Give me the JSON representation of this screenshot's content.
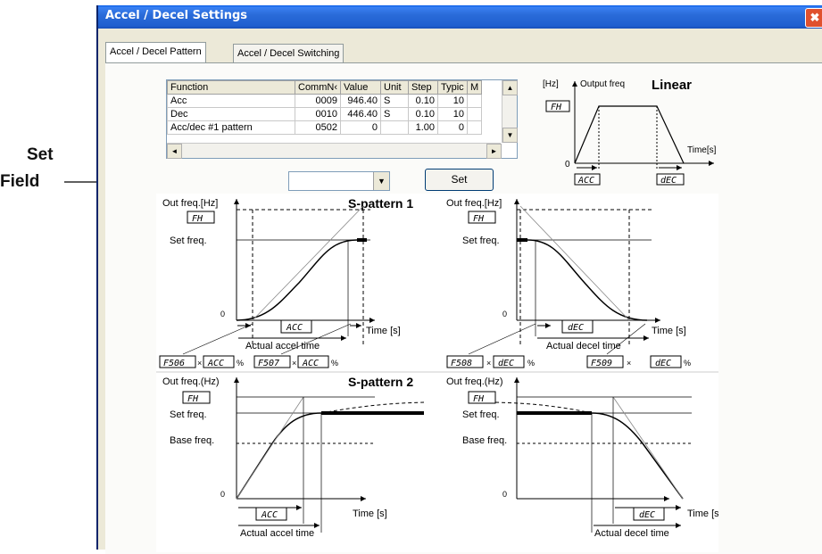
{
  "callout": {
    "line1": "Set",
    "line2": "Field"
  },
  "window": {
    "title": "Accel / Decel Settings",
    "close_glyph": "✖"
  },
  "tabs": [
    {
      "label": "Accel / Decel Pattern",
      "active": true
    },
    {
      "label": "Accel / Decel Switching",
      "active": false
    }
  ],
  "grid": {
    "columns": [
      "Function",
      "CommN‹",
      "Value",
      "Unit",
      "Step",
      "Typic",
      "M"
    ],
    "rows": [
      [
        "Acc",
        "0009",
        "946.40",
        "S",
        "0.10",
        "10",
        ""
      ],
      [
        "Dec",
        "0010",
        "446.40",
        "S",
        "0.10",
        "10",
        ""
      ],
      [
        "Acc/dec #1 pattern",
        "0502",
        "0",
        "",
        "1.00",
        "0",
        ""
      ]
    ]
  },
  "combo": {
    "value": ""
  },
  "set_button": {
    "label": "Set"
  },
  "icons": {
    "scroll_up": "▲",
    "scroll_down": "▼",
    "scroll_left": "◄",
    "scroll_right": "►",
    "dropdown": "▼"
  },
  "linear": {
    "title": "Linear",
    "hz": "[Hz]",
    "ylabel": "Output freq",
    "time": "Time[s]",
    "zero": "0",
    "fh": "FH",
    "acc": "ACC",
    "dec": "dEC"
  },
  "s1": {
    "title": "S-pattern 1",
    "yaxis": "Out freq.[Hz]",
    "fh": "FH",
    "set_freq": "Set freq.",
    "zero": "0",
    "time": "Time [s]",
    "acc": "ACC",
    "dec": "dEC",
    "actual_accel": "Actual accel time",
    "actual_decel": "Actual decel time",
    "f506": "F506",
    "f507": "F507",
    "f508": "F508",
    "f509": "F509",
    "times": "×",
    "pct": "%"
  },
  "s2": {
    "title": "S-pattern 2",
    "yaxis": "Out freq.(Hz)",
    "fh": "FH",
    "set_freq": "Set freq.",
    "base_freq": "Base freq.",
    "zero": "0",
    "time": "Time [s]",
    "acc": "ACC",
    "dec": "dEC",
    "actual_accel": "Actual accel time",
    "actual_decel": "Actual decel time"
  }
}
